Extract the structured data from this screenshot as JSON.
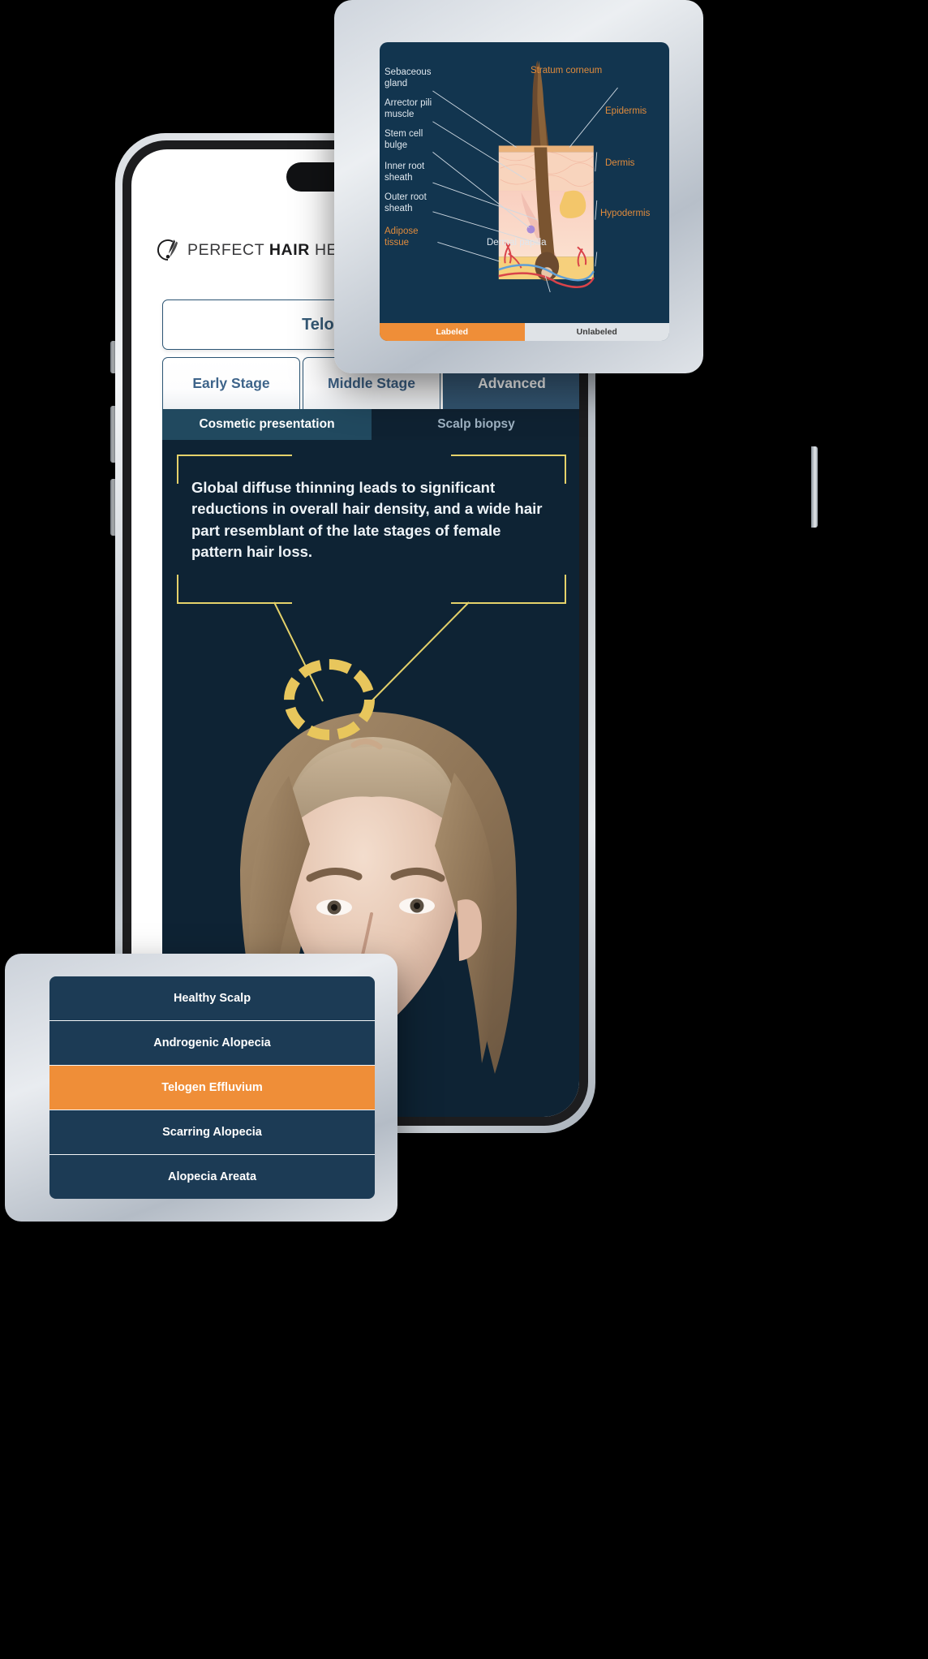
{
  "brand": {
    "part1": "PERFECT ",
    "bold": "HAIR",
    "part2": " HEALTH",
    "logo_icon": "hair-follicle-logo-icon"
  },
  "header": {
    "condition_title": "Telogen Effluvium"
  },
  "stage_tabs": [
    {
      "label": "Early Stage",
      "active": false
    },
    {
      "label": "Middle Stage",
      "active": false
    },
    {
      "label": "Advanced",
      "active": true
    }
  ],
  "sub_tabs": [
    {
      "label": "Cosmetic presentation",
      "active": true
    },
    {
      "label": "Scalp biopsy",
      "active": false
    }
  ],
  "viewer": {
    "description": "Global diffuse thinning leads to significant reductions in overall hair density, and a wide hair part resemblant of the late stages of female pattern hair loss.",
    "illustration": "female-scalp-hair-thinning-render",
    "highlight_region": "crown-thinning-highlight-ring"
  },
  "diagram_card": {
    "title_image": "hair-follicle-cross-section-diagram",
    "labels_left": [
      "Sebaceous gland",
      "Arrector pili muscle",
      "Stem cell bulge",
      "Inner root sheath",
      "Outer root sheath",
      "Adipose tissue"
    ],
    "labels_right": [
      "Stratum corneum",
      "Epidermis",
      "Dermis",
      "Hypodermis"
    ],
    "label_bottom": "Dermal papilla",
    "accent_labels": [
      "Adipose tissue",
      "Stratum corneum",
      "Epidermis",
      "Dermis",
      "Hypodermis"
    ],
    "toggles": [
      {
        "label": "Labeled",
        "active": true
      },
      {
        "label": "Unlabeled",
        "active": false
      }
    ]
  },
  "condition_list": [
    {
      "label": "Healthy Scalp",
      "selected": false
    },
    {
      "label": "Androgenic Alopecia",
      "selected": false
    },
    {
      "label": "Telogen Effluvium",
      "selected": true
    },
    {
      "label": "Scarring Alopecia",
      "selected": false
    },
    {
      "label": "Alopecia Areata",
      "selected": false
    }
  ],
  "colors": {
    "brand_orange": "#ef8e38",
    "deep_navy": "#12354f",
    "viewer_navy": "#0e2334",
    "tab_blue": "#32546f",
    "callout_yellow": "#e4d16a"
  }
}
